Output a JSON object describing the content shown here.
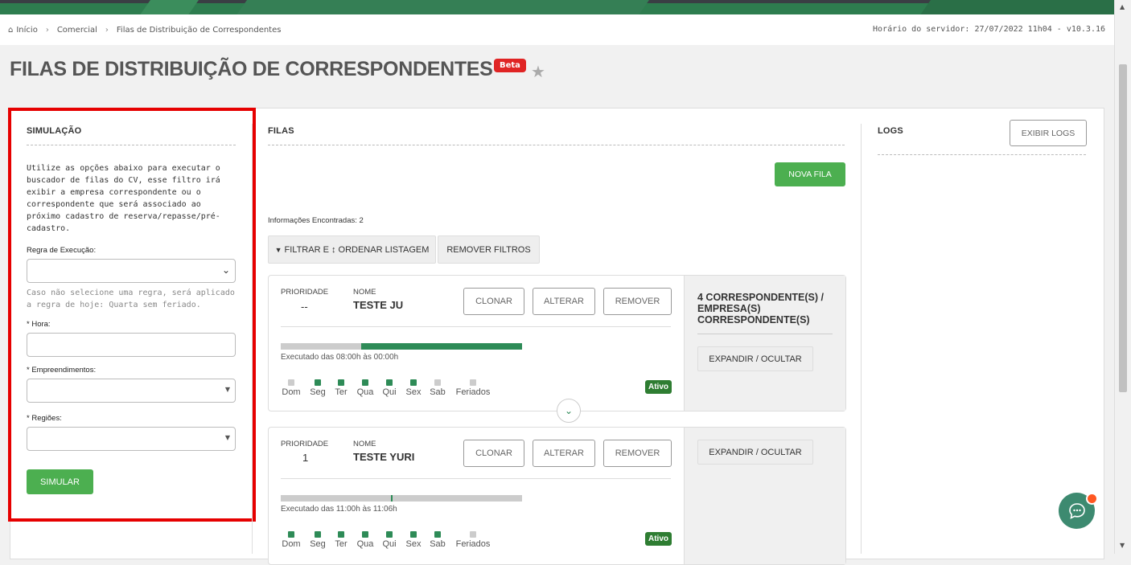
{
  "breadcrumb": {
    "home": "Início",
    "commercial": "Comercial",
    "current": "Filas de Distribuição de Correspondentes"
  },
  "server_time": "Horário do servidor: 27/07/2022 11h04 - v10.3.16",
  "page": {
    "title": "FILAS DE DISTRIBUIÇÃO DE CORRESPONDENTES",
    "badge": "Beta"
  },
  "simulation": {
    "heading": "SIMULAÇÃO",
    "description": "Utilize as opções abaixo para executar o buscador de filas do CV, esse filtro irá exibir a empresa correspondente ou o correspondente que será associado ao próximo cadastro de reserva/repasse/pré-cadastro.",
    "rule_label": "Regra de Execução:",
    "rule_hint": "Caso não selecione uma regra, será aplicado a regra de hoje: Quarta sem feriado.",
    "hour_label": "Hora:",
    "developments_label": "Empreendimentos:",
    "regions_label": "Regiões:",
    "simulate_button": "SIMULAR"
  },
  "queues": {
    "heading": "FILAS",
    "new_button": "NOVA FILA",
    "info_found": "Informações Encontradas: 2",
    "filter_button": "FILTRAR E ↕ ORDENAR LISTAGEM",
    "remove_filters_button": "REMOVER FILTROS",
    "priority_label": "PRIORIDADE",
    "name_label": "NOME",
    "clone_label": "CLONAR",
    "edit_label": "ALTERAR",
    "remove_label": "REMOVER",
    "expand_label": "EXPANDIR / OCULTAR",
    "days": [
      "Dom",
      "Seg",
      "Ter",
      "Qua",
      "Qui",
      "Sex",
      "Sab",
      "Feriados"
    ],
    "items": [
      {
        "priority": "--",
        "name": "TESTE JU",
        "executed": "Executado das 08:00h às 00:00h",
        "status": "Ativo",
        "correspondents": "4 CORRESPONDENTE(S) / EMPRESA(S) CORRESPONDENTE(S)"
      },
      {
        "priority": "1",
        "name": "TESTE YURI",
        "executed": "Executado das 11:00h às 11:06h",
        "status": "Ativo"
      }
    ]
  },
  "logs": {
    "heading": "LOGS",
    "show_button": "EXIBIR LOGS"
  },
  "colors": {
    "brand_green": "#2e7d4f",
    "button_green": "#4caf50",
    "highlight_red": "#e60000",
    "beta_red": "#e02424"
  }
}
